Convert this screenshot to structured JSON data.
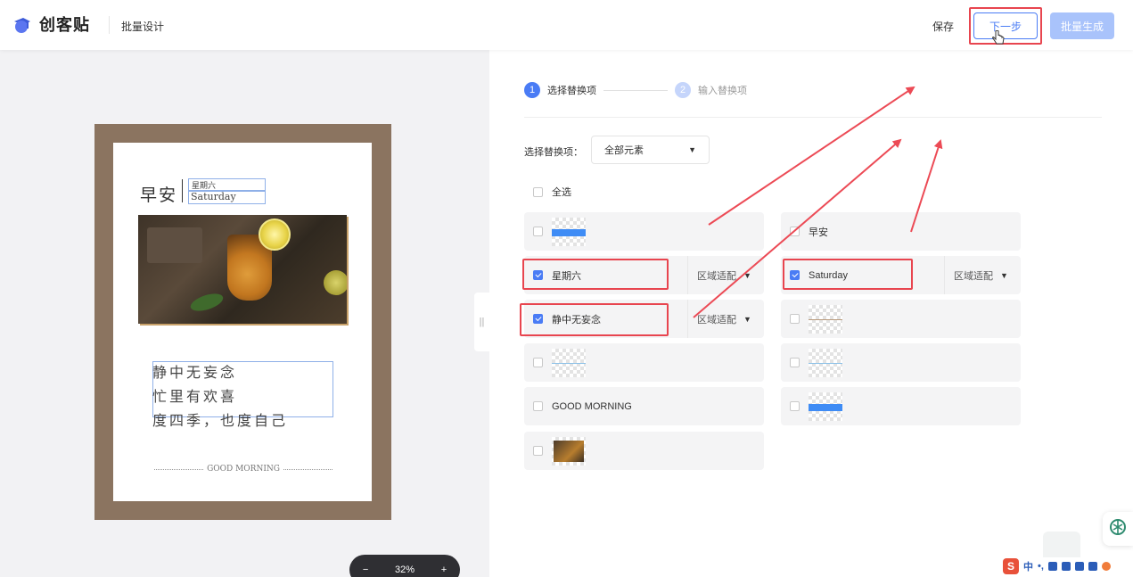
{
  "header": {
    "brand": "创客贴",
    "page_title": "批量设计",
    "save_label": "保存",
    "next_label": "下一步",
    "generate_label": "批量生成"
  },
  "canvas": {
    "greeting": "早安",
    "weekday": "星期六",
    "day_en": "Saturday",
    "poem": [
      "静中无妄念",
      "忙里有欢喜",
      "度四季，也度自己"
    ],
    "footer": "GOOD MORNING",
    "zoom": "32%",
    "zoom_minus": "−",
    "zoom_plus": "+"
  },
  "steps": [
    {
      "num": "1",
      "label": "选择替换项",
      "active": true
    },
    {
      "num": "2",
      "label": "输入替换项",
      "active": false
    }
  ],
  "selector": {
    "label": "选择替换项：",
    "value": "全部元素",
    "select_all": "全选"
  },
  "fit_label": "区域适配",
  "items": {
    "blue_bar": "",
    "greeting": "早安",
    "weekday": "星期六",
    "saturday": "Saturday",
    "poem": "静中无妄念",
    "brown_line": "",
    "blue_line": "",
    "blue_line2": "",
    "good_morning": "GOOD MORNING",
    "blue_rect": "",
    "photo": ""
  },
  "ime": {
    "logo": "S",
    "mode": "中",
    "punct": "•,"
  },
  "colors": {
    "accent": "#4a7cf5",
    "highlight": "#e8454f",
    "card_frame": "#8b7460"
  }
}
